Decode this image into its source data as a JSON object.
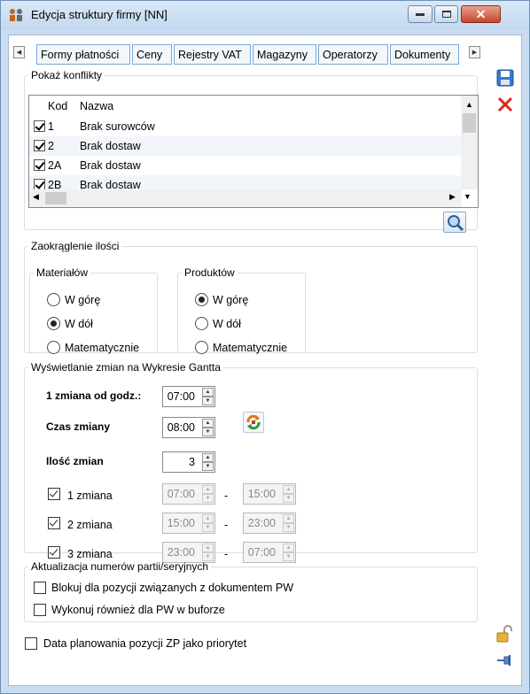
{
  "window": {
    "title": "Edycja struktury firmy [NN]"
  },
  "tabs": [
    "Formy płatności",
    "Ceny",
    "Rejestry VAT",
    "Magazyny",
    "Operatorzy",
    "Dokumenty"
  ],
  "conflicts": {
    "legend": "Pokaż konflikty",
    "columns": {
      "kod": "Kod",
      "nazwa": "Nazwa"
    },
    "rows": [
      {
        "kod": "1",
        "nazwa": "Brak surowców",
        "checked": true
      },
      {
        "kod": "2",
        "nazwa": "Brak dostaw",
        "checked": true
      },
      {
        "kod": "2A",
        "nazwa": "Brak dostaw",
        "checked": true
      },
      {
        "kod": "2B",
        "nazwa": "Brak dostaw",
        "checked": true
      }
    ]
  },
  "rounding": {
    "legend": "Zaokrąglenie ilości",
    "materials": {
      "legend": "Materiałów",
      "options": [
        "W górę",
        "W dół",
        "Matematycznie"
      ],
      "selected": "W dół"
    },
    "products": {
      "legend": "Produktów",
      "options": [
        "W górę",
        "W dół",
        "Matematycznie"
      ],
      "selected": "W górę"
    }
  },
  "gantt": {
    "legend": "Wyświetlanie zmian na Wykresie Gantta",
    "first_shift_label": "1 zmiana od godz.:",
    "first_shift_value": "07:00",
    "shift_time_label": "Czas zmiany",
    "shift_time_value": "08:00",
    "shift_count_label": "Ilość zmian",
    "shift_count_value": "3",
    "dash": "-",
    "shifts": [
      {
        "label": "1 zmiana",
        "checked": true,
        "from": "07:00",
        "to": "15:00"
      },
      {
        "label": "2 zmiana",
        "checked": true,
        "from": "15:00",
        "to": "23:00"
      },
      {
        "label": "3 zmiana",
        "checked": true,
        "from": "23:00",
        "to": "07:00"
      }
    ]
  },
  "batch": {
    "legend": "Aktualizacja numerów partii/seryjnych",
    "options": [
      {
        "label": "Blokuj dla pozycji związanych z dokumentem PW",
        "checked": false
      },
      {
        "label": "Wykonuj również dla PW w buforze",
        "checked": false
      }
    ]
  },
  "priority": {
    "label": "Data planowania pozycji ZP jako priorytet",
    "checked": false
  },
  "colors": {
    "accent": "#2b6cb0",
    "delete": "#d9251c",
    "window_frame": "#c9dcf0"
  }
}
